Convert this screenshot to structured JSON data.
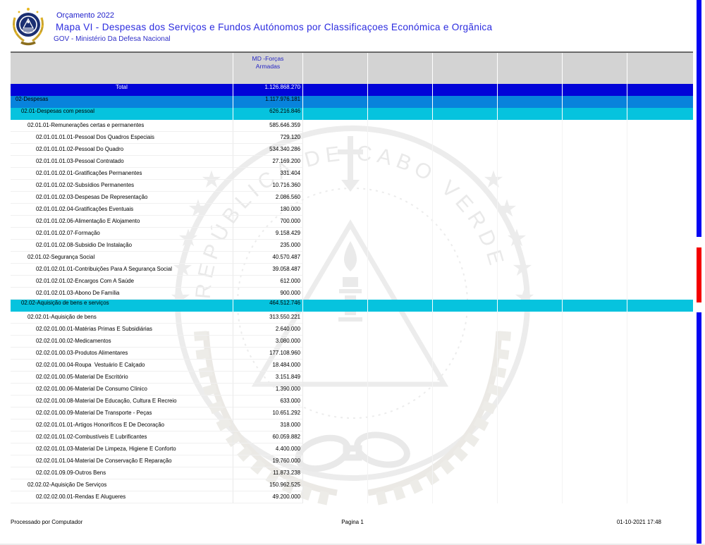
{
  "header": {
    "small_title": "Orçamento 2022",
    "main_title": "Mapa VI - Despesas dos Serviços e Fundos Autónomos por Classificaçoes Económica e Orgãnica",
    "subtitle": "GOV - Ministério Da Defesa Nacional"
  },
  "table": {
    "column_header": {
      "line1": "MD -Forças",
      "line2": "Armadas"
    },
    "rows": [
      {
        "label": "Total",
        "value": "1.126.868.270",
        "type": "total",
        "level": 0
      },
      {
        "label": "02-Despesas",
        "value": "1.117.976.181",
        "type": "section1",
        "level": 1
      },
      {
        "label": "02.01-Despesas com pessoal",
        "value": "626.216.846",
        "type": "section2",
        "level": 2
      },
      {
        "label": "02.01.01-Remunerações certas e permanentes",
        "value": "585.646.359",
        "type": "item",
        "level": 3
      },
      {
        "label": "02.01.01.01.01-Pessoal Dos Quadros Especiais",
        "value": "729.120",
        "type": "item",
        "level": 4
      },
      {
        "label": "02.01.01.01.02-Pessoal Do Quadro",
        "value": "534.340.286",
        "type": "item",
        "level": 4
      },
      {
        "label": "02.01.01.01.03-Pessoal Contratado",
        "value": "27.169.200",
        "type": "item",
        "level": 4
      },
      {
        "label": "02.01.01.02.01-Gratificações Permanentes",
        "value": "331.404",
        "type": "item",
        "level": 4
      },
      {
        "label": "02.01.01.02.02-Subsídios Permanentes",
        "value": "10.716.360",
        "type": "item",
        "level": 4
      },
      {
        "label": "02.01.01.02.03-Despesas De Representação",
        "value": "2.086.560",
        "type": "item",
        "level": 4
      },
      {
        "label": "02.01.01.02.04-Gratificações Eventuais",
        "value": "180.000",
        "type": "item",
        "level": 4
      },
      {
        "label": "02.01.01.02.06-Alimentação E Alojamento",
        "value": "700.000",
        "type": "item",
        "level": 4
      },
      {
        "label": "02.01.01.02.07-Formação",
        "value": "9.158.429",
        "type": "item",
        "level": 4
      },
      {
        "label": "02.01.01.02.08-Subsidio De Instalação",
        "value": "235.000",
        "type": "item",
        "level": 4
      },
      {
        "label": "02.01.02-Segurança Social",
        "value": "40.570.487",
        "type": "item",
        "level": 3
      },
      {
        "label": "02.01.02.01.01-Contribuições Para A Segurança Social",
        "value": "39.058.487",
        "type": "item",
        "level": 4
      },
      {
        "label": "02.01.02.01.02-Encargos Com A Saúde",
        "value": "612.000",
        "type": "item",
        "level": 4
      },
      {
        "label": "02.01.02.01.03-Abono De Família",
        "value": "900.000",
        "type": "item",
        "level": 4
      },
      {
        "label": "02.02-Aquisição de bens e serviços",
        "value": "464.512.746",
        "type": "section2",
        "level": 2
      },
      {
        "label": "02.02.01-Aquisição de bens",
        "value": "313.550.221",
        "type": "item",
        "level": 3
      },
      {
        "label": "02.02.01.00.01-Matérias Primas E Subsidiárias",
        "value": "2.640.000",
        "type": "item",
        "level": 4
      },
      {
        "label": "02.02.01.00.02-Medicamentos",
        "value": "3.080.000",
        "type": "item",
        "level": 4
      },
      {
        "label": "02.02.01.00.03-Produtos Alimentares",
        "value": "177.108.960",
        "type": "item",
        "level": 4
      },
      {
        "label": "02.02.01.00.04-Roupa  Vestuário E Calçado",
        "value": "18.484.000",
        "type": "item",
        "level": 4
      },
      {
        "label": "02.02.01.00.05-Material De Escritório",
        "value": "3.151.849",
        "type": "item",
        "level": 4
      },
      {
        "label": "02.02.01.00.06-Material De Consumo Clínico",
        "value": "1.390.000",
        "type": "item",
        "level": 4
      },
      {
        "label": "02.02.01.00.08-Material De Educação, Cultura E Recreio",
        "value": "633.000",
        "type": "item",
        "level": 4
      },
      {
        "label": "02.02.01.00.09-Material De Transporte - Peças",
        "value": "10.651.292",
        "type": "item",
        "level": 4
      },
      {
        "label": "02.02.01.01.01-Artigos Honoríficos E De Decoração",
        "value": "318.000",
        "type": "item",
        "level": 4
      },
      {
        "label": "02.02.01.01.02-Combustíveis E Lubrificantes",
        "value": "60.059.882",
        "type": "item",
        "level": 4
      },
      {
        "label": "02.02.01.01.03-Material De Limpeza, Higiene E Conforto",
        "value": "4.400.000",
        "type": "item",
        "level": 4
      },
      {
        "label": "02.02.01.01.04-Material De Conservação E Reparação",
        "value": "19.760.000",
        "type": "item",
        "level": 4
      },
      {
        "label": "02.02.01.09.09-Outros Bens",
        "value": "11.873.238",
        "type": "item",
        "level": 4
      },
      {
        "label": "02.02.02-Aquisição De Serviços",
        "value": "150.962.525",
        "type": "item",
        "level": 3
      },
      {
        "label": "02.02.02.00.01-Rendas E Alugueres",
        "value": "49.200.000",
        "type": "item",
        "level": 4
      }
    ]
  },
  "footer": {
    "left": "Processado por Computador",
    "center": "Pagina 1",
    "right": "01-10-2021   17:48"
  },
  "colors": {
    "total_row": "#0103d8",
    "section1_row": "#0883dc",
    "section2_row": "#06c3de",
    "header_bg": "#d3d3d3",
    "header_text_blue": "#2525c4",
    "title_blue": "#2b2bdf",
    "edge_bar_blue": "#0505f2",
    "edge_bar_red": "#f40000"
  }
}
